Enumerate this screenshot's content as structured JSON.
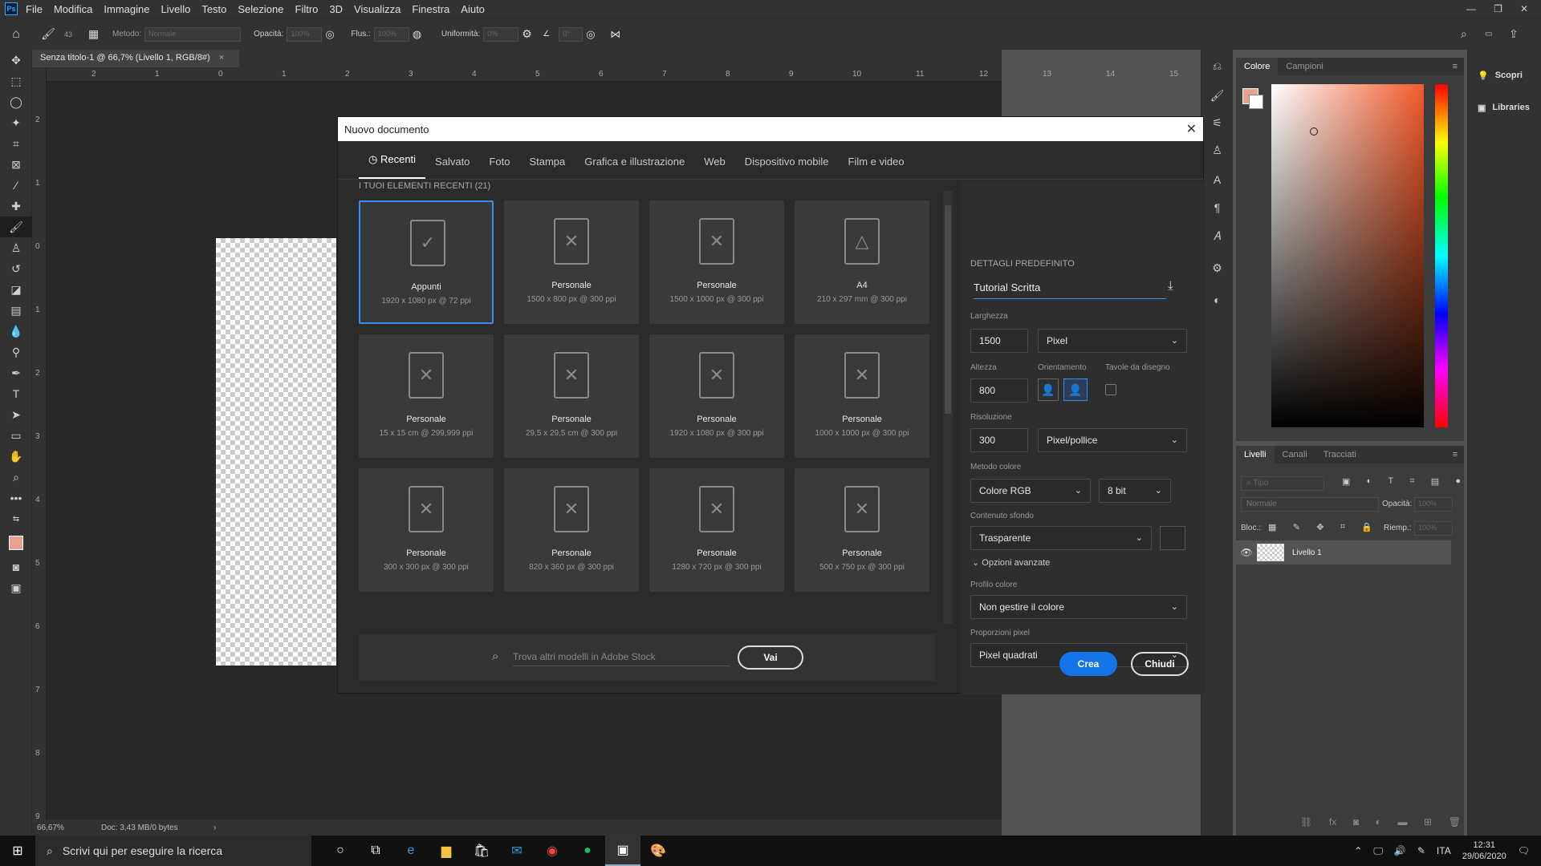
{
  "menubar": {
    "items": [
      "File",
      "Modifica",
      "Immagine",
      "Livello",
      "Testo",
      "Selezione",
      "Filtro",
      "3D",
      "Visualizza",
      "Finestra",
      "Aiuto"
    ],
    "logo": "Ps"
  },
  "options": {
    "method_label": "Metodo:",
    "method_value": "Normale",
    "opacity_label": "Opacità:",
    "opacity_value": "100%",
    "flow_label": "Flus.:",
    "flow_value": "100%",
    "smooth_label": "Uniformità:",
    "smooth_value": "0%",
    "angle_value": "0°",
    "brush_size": "43"
  },
  "document": {
    "tab_title": "Senza titolo-1 @ 66,7% (Livello 1, RGB/8#)",
    "zoom": "66,67%",
    "doc_info": "Doc: 3,43 MB/0 bytes"
  },
  "ruler": {
    "h": [
      "2",
      "1",
      "0",
      "1",
      "2",
      "3",
      "4",
      "5",
      "6",
      "7",
      "8",
      "9",
      "10",
      "11",
      "12",
      "13",
      "14",
      "15"
    ],
    "v": [
      "2",
      "1",
      "0",
      "1",
      "2",
      "3",
      "4",
      "5",
      "6",
      "7",
      "8",
      "9"
    ]
  },
  "panels": {
    "color_tabs": [
      "Colore",
      "Campioni"
    ],
    "layer_tabs": [
      "Livelli",
      "Canali",
      "Tracciati"
    ],
    "search_placeholder": "Tipo",
    "blend": "Normale",
    "opacity_label": "Opacità:",
    "opacity_value": "100%",
    "lock_label": "Bloc.:",
    "fill_label": "Riemp.:",
    "fill_value": "100%",
    "layer_name": "Livello 1"
  },
  "right": {
    "discover": "Scopri",
    "libraries": "Libraries"
  },
  "dialog": {
    "title": "Nuovo documento",
    "tabs": [
      "Recenti",
      "Salvato",
      "Foto",
      "Stampa",
      "Grafica e illustrazione",
      "Web",
      "Dispositivo mobile",
      "Film e video"
    ],
    "recent_header": "I TUOI ELEMENTI RECENTI",
    "recent_count": "(21)",
    "cards": [
      {
        "name": "Appunti",
        "desc": "1920 x 1080 px @ 72 ppi",
        "icon": "clipboard-icon"
      },
      {
        "name": "Personale",
        "desc": "1500 x 800 px @ 300 ppi",
        "icon": "doc-x-icon"
      },
      {
        "name": "Personale",
        "desc": "1500 x 1000 px @ 300 ppi",
        "icon": "doc-x-icon"
      },
      {
        "name": "A4",
        "desc": "210 x 297 mm @ 300 ppi",
        "icon": "doc-shapes-icon"
      },
      {
        "name": "Personale",
        "desc": "15 x 15 cm @ 299,999 ppi",
        "icon": "doc-x-icon"
      },
      {
        "name": "Personale",
        "desc": "29,5 x 29,5 cm @ 300 ppi",
        "icon": "doc-x-icon"
      },
      {
        "name": "Personale",
        "desc": "1920 x 1080 px @ 300 ppi",
        "icon": "doc-x-icon"
      },
      {
        "name": "Personale",
        "desc": "1000 x 1000 px @ 300 ppi",
        "icon": "doc-x-icon"
      },
      {
        "name": "Personale",
        "desc": "300 x 300 px @ 300 ppi",
        "icon": "doc-x-icon"
      },
      {
        "name": "Personale",
        "desc": "820 x 360 px @ 300 ppi",
        "icon": "doc-x-icon"
      },
      {
        "name": "Personale",
        "desc": "1280 x 720 px @ 300 ppi",
        "icon": "doc-x-icon"
      },
      {
        "name": "Personale",
        "desc": "500 x 750 px @ 300 ppi",
        "icon": "doc-x-icon"
      }
    ],
    "search_placeholder": "Trova altri modelli in Adobe Stock",
    "go": "Vai",
    "details": {
      "header": "DETTAGLI PREDEFINITO",
      "preset_name": "Tutorial Scritta",
      "width_label": "Larghezza",
      "width": "1500",
      "width_unit": "Pixel",
      "height_label": "Altezza",
      "height": "800",
      "orientation_label": "Orientamento",
      "artboards_label": "Tavole da disegno",
      "resolution_label": "Risoluzione",
      "resolution": "300",
      "resolution_unit": "Pixel/pollice",
      "color_mode_label": "Metodo colore",
      "color_mode": "Colore RGB",
      "bit_depth": "8 bit",
      "background_label": "Contenuto sfondo",
      "background": "Trasparente",
      "advanced": "Opzioni avanzate",
      "profile_label": "Profilo colore",
      "profile": "Non gestire il colore",
      "pixel_aspect_label": "Proporzioni pixel",
      "pixel_aspect": "Pixel quadrati"
    },
    "create": "Crea",
    "close": "Chiudi"
  },
  "taskbar": {
    "search": "Scrivi qui per eseguire la ricerca",
    "lang": "ITA",
    "time": "12:31",
    "date": "29/06/2020"
  },
  "colors": {
    "accent": "#378ef0",
    "foreground": "#e8a090"
  }
}
